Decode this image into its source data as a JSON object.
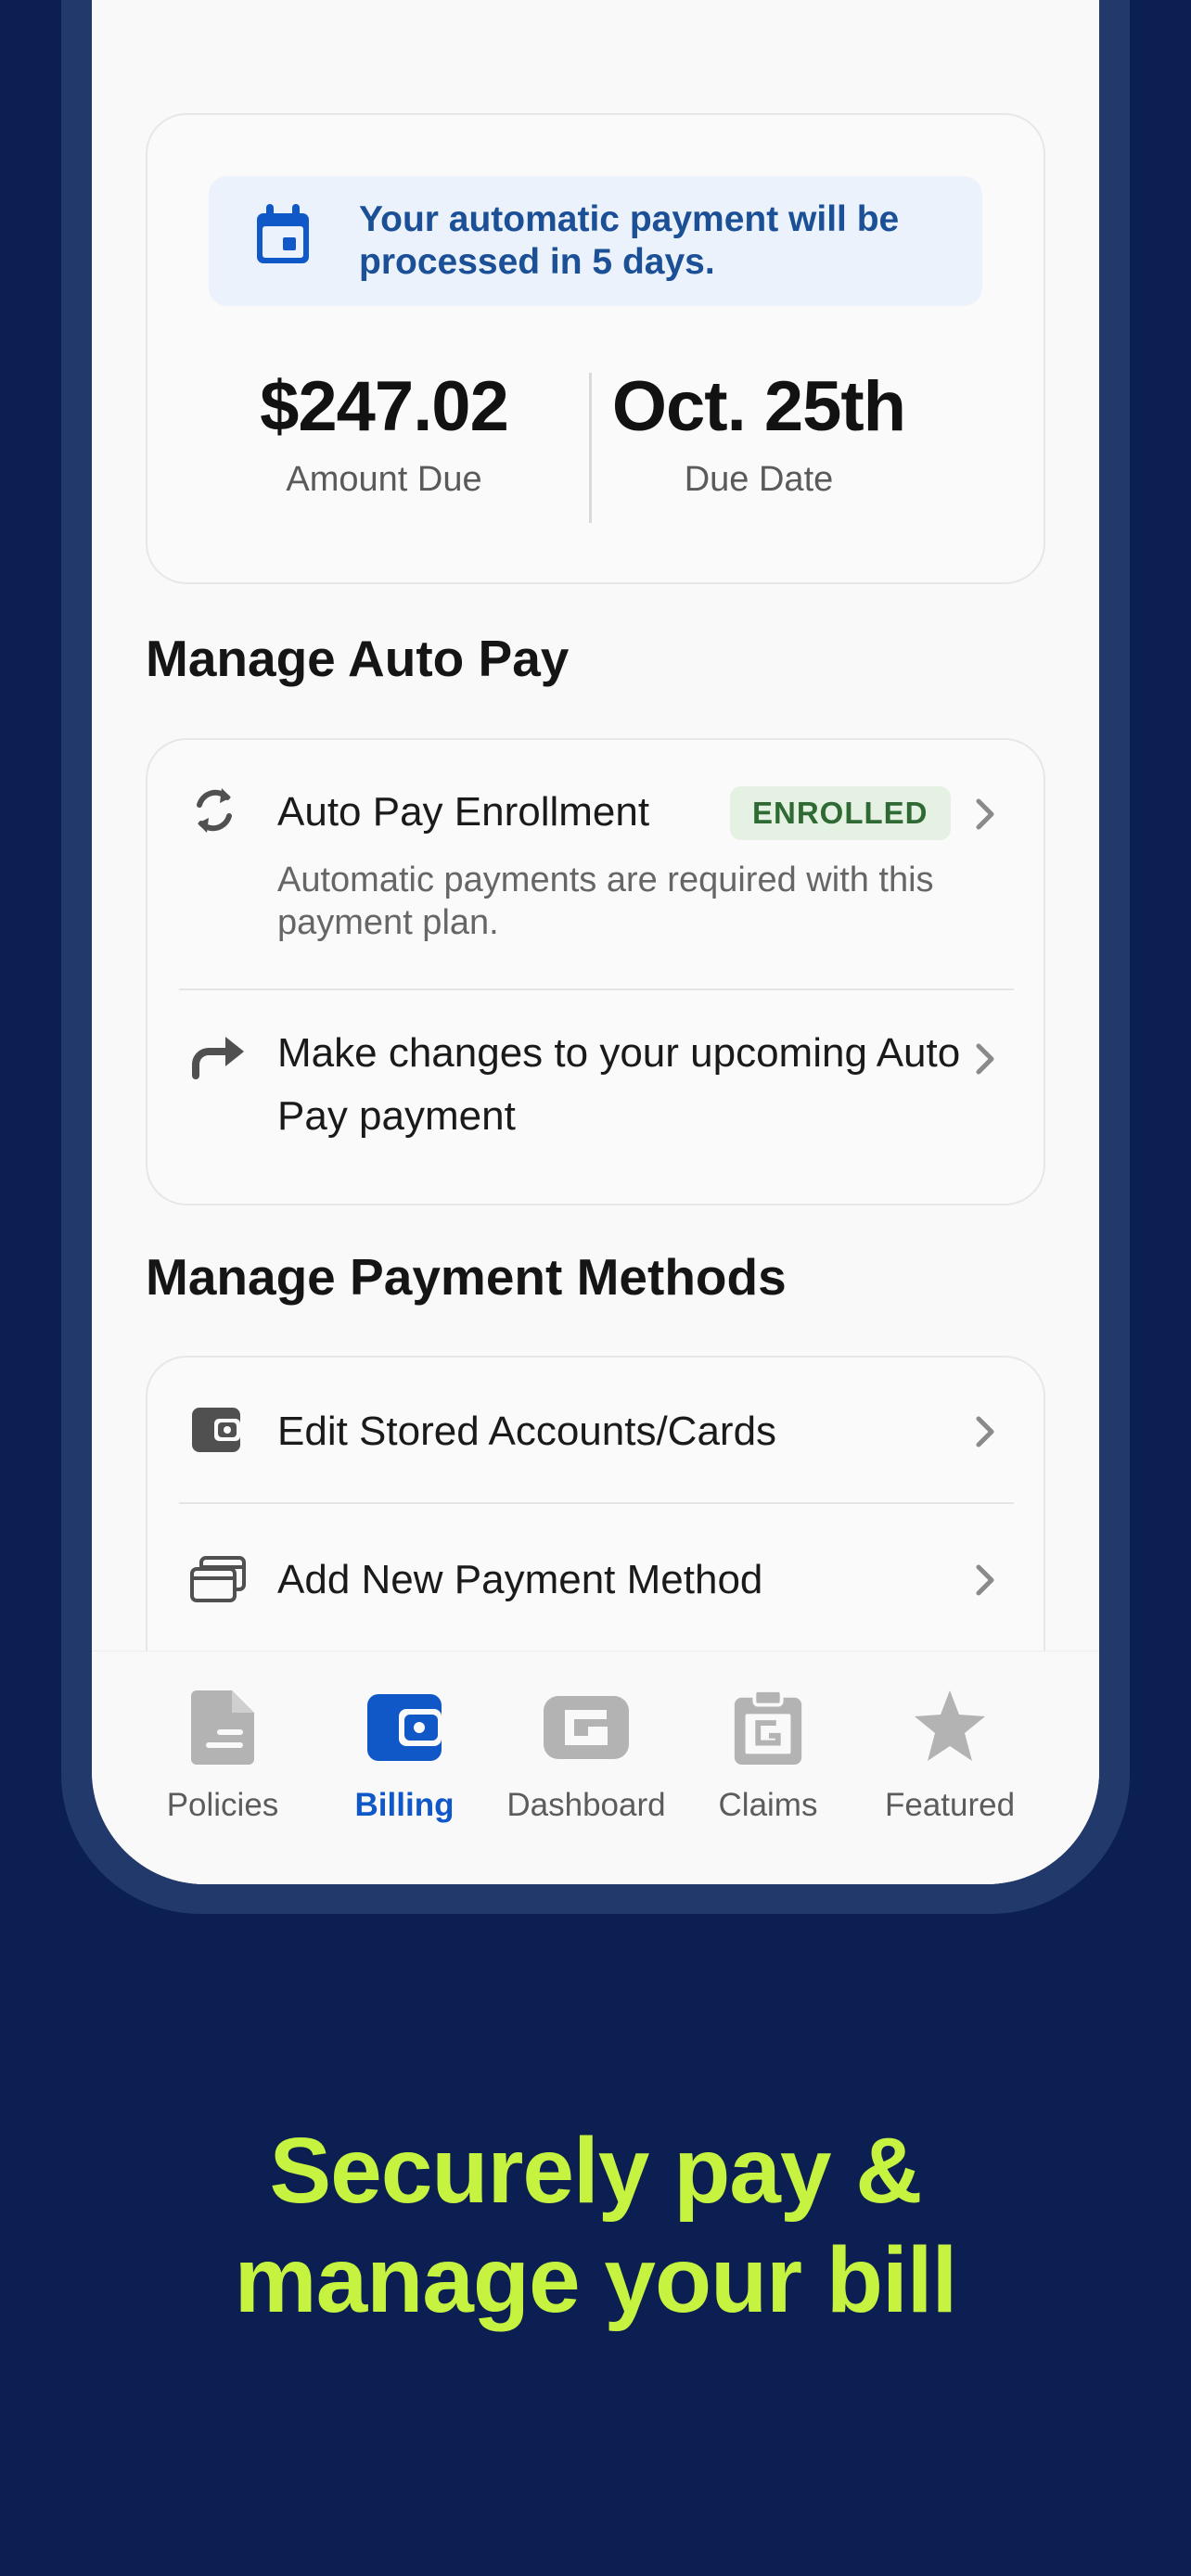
{
  "summary": {
    "alert_text": "Your automatic payment will be processed in 5 days.",
    "amount": "$247.02",
    "amount_label": "Amount Due",
    "date": "Oct. 25th",
    "date_label": "Due Date"
  },
  "autopay": {
    "section_title": "Manage Auto Pay",
    "enrollment": {
      "title": "Auto Pay Enrollment",
      "badge": "ENROLLED",
      "description": "Automatic payments are required with this payment plan."
    },
    "changes": {
      "title": "Make changes to your upcoming Auto Pay payment"
    }
  },
  "payment_methods": {
    "section_title": "Manage Payment Methods",
    "items": [
      {
        "label": "Edit Stored Accounts/Cards",
        "icon": "wallet-icon"
      },
      {
        "label": "Add New Payment Method",
        "icon": "cards-icon"
      }
    ]
  },
  "nav": {
    "items": [
      {
        "label": "Policies",
        "icon": "document-icon"
      },
      {
        "label": "Billing",
        "icon": "wallet-icon",
        "active": true
      },
      {
        "label": "Dashboard",
        "icon": "g-logo-icon"
      },
      {
        "label": "Claims",
        "icon": "clipboard-icon"
      },
      {
        "label": "Featured",
        "icon": "star-icon"
      }
    ]
  },
  "colors": {
    "background": "#0c1f52",
    "accent": "#1057c8",
    "tagline": "#c6f240",
    "enrolled_badge": "#e5f1e2"
  },
  "tagline": {
    "line1": "Securely pay &",
    "line2": "manage your bill"
  }
}
